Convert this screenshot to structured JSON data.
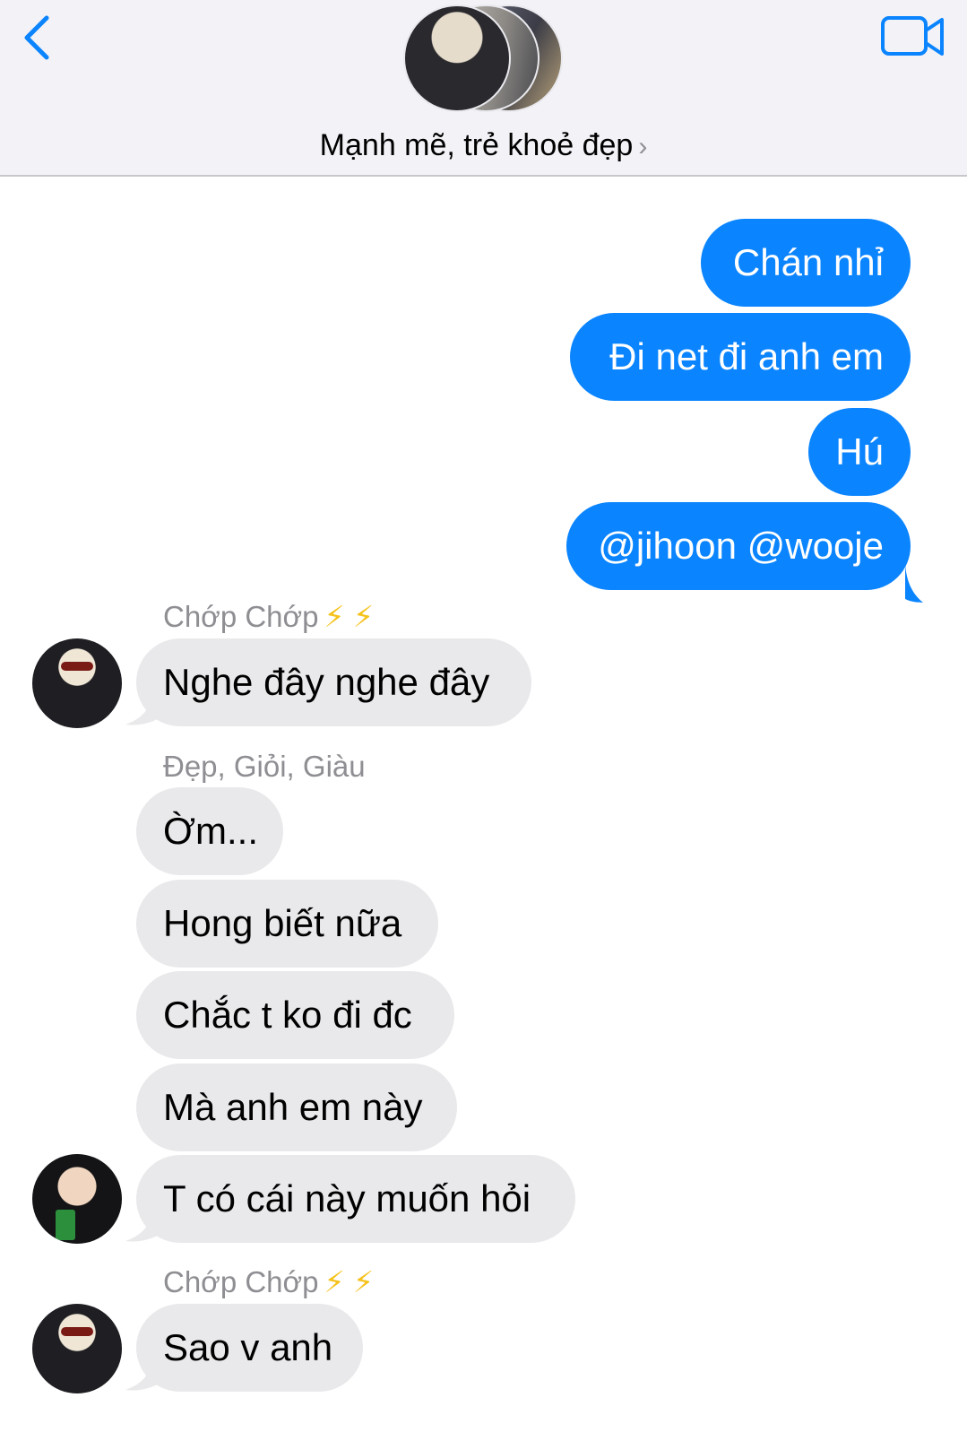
{
  "header": {
    "group_name": "Mạnh mẽ, trẻ khoẻ đẹp",
    "chevron": "›",
    "back_icon": "chevron-left-icon",
    "video_icon": "video-camera-icon"
  },
  "colors": {
    "outgoing_bubble": "#0a84ff",
    "incoming_bubble": "#e9e9eb",
    "accent": "#0a84ff"
  },
  "messages": {
    "outgoing": [
      "Chán nhỉ",
      "Đi net đi anh em",
      "Hú",
      "@jihoon @wooje"
    ],
    "group1": {
      "sender": "Chớp Chớp",
      "emoji": "⚡ ⚡",
      "texts": [
        "Nghe đây nghe đây"
      ]
    },
    "group2": {
      "sender": "Đẹp, Giỏi, Giàu",
      "texts": [
        "Ờm...",
        "Hong biết nữa",
        "Chắc t ko đi đc",
        "Mà anh em này",
        "T có cái này muốn hỏi"
      ]
    },
    "group3": {
      "sender": "Chớp Chớp",
      "emoji": "⚡ ⚡",
      "texts": [
        "Sao v anh"
      ]
    }
  }
}
